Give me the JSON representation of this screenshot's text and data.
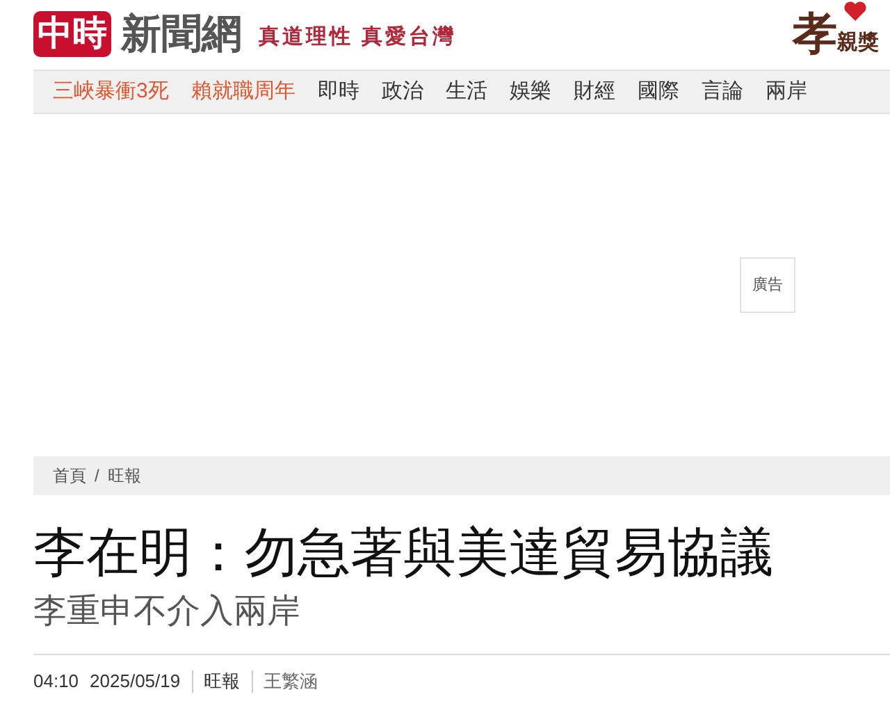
{
  "header": {
    "logo_mark": "中時",
    "logo_text": "新聞網",
    "slogan": "真道理性 真愛台灣",
    "award_logo": {
      "big": "孝",
      "small": "親獎"
    }
  },
  "nav": [
    {
      "label": "三峽暴衝3死",
      "kind": "hot"
    },
    {
      "label": "賴就職周年",
      "kind": "hot"
    },
    {
      "label": "即時",
      "kind": "section"
    },
    {
      "label": "政治",
      "kind": "section"
    },
    {
      "label": "生活",
      "kind": "section"
    },
    {
      "label": "娛樂",
      "kind": "section"
    },
    {
      "label": "財經",
      "kind": "section"
    },
    {
      "label": "國際",
      "kind": "section"
    },
    {
      "label": "言論",
      "kind": "section"
    },
    {
      "label": "兩岸",
      "kind": "section"
    }
  ],
  "ad": {
    "label": "廣告"
  },
  "breadcrumb": [
    "首頁",
    "/",
    "旺報"
  ],
  "article": {
    "title": "李在明：勿急著與美達貿易協議",
    "subtitle": "李重申不介入兩岸",
    "time": "04:10",
    "date": "2025/05/19",
    "source": "旺報",
    "author": "王繁涵"
  }
}
